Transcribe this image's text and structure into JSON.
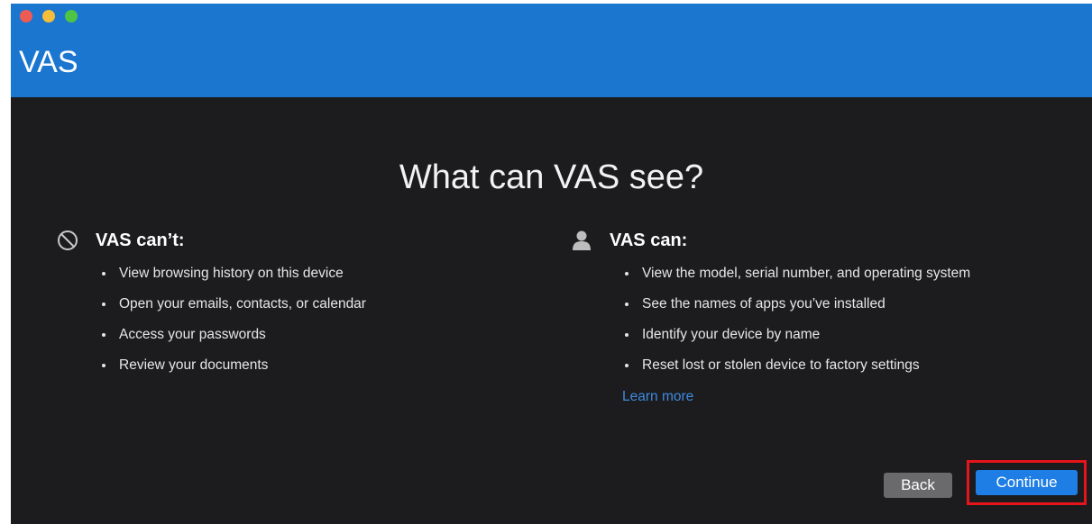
{
  "window": {
    "title": "VAS",
    "colors": {
      "titlebar": "#1b76d0",
      "background": "#1c1c1e",
      "accent": "#1f7ee5",
      "highlight": "#e6141b"
    }
  },
  "headline": "What can VAS see?",
  "cannot": {
    "icon": "prohibited-icon",
    "heading": "VAS can’t:",
    "items": [
      "View browsing history on this device",
      "Open your emails, contacts, or calendar",
      "Access your passwords",
      "Review your documents"
    ]
  },
  "can": {
    "icon": "person-icon",
    "heading": "VAS can:",
    "items": [
      "View the model, serial number, and operating system",
      "See the names of apps you’ve installed",
      "Identify your device by name",
      "Reset lost or stolen device to factory settings"
    ],
    "learn_more": "Learn more"
  },
  "buttons": {
    "back": "Back",
    "continue": "Continue"
  }
}
